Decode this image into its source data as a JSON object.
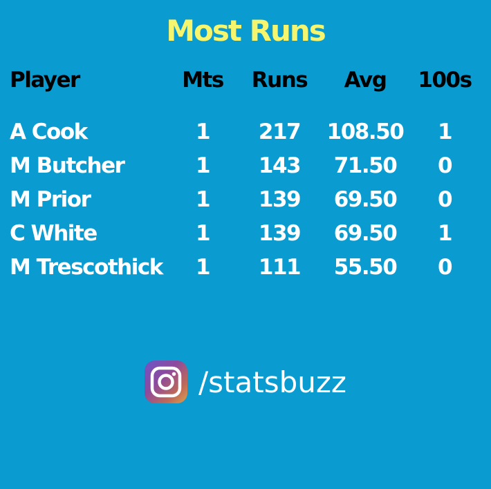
{
  "title": "Most Runs",
  "columns": {
    "player": "Player",
    "mts": "Mts",
    "runs": "Runs",
    "avg": "Avg",
    "hundreds": "100s"
  },
  "rows": [
    {
      "player": "A Cook",
      "mts": "1",
      "runs": "217",
      "avg": "108.50",
      "hundreds": "1"
    },
    {
      "player": "M Butcher",
      "mts": "1",
      "runs": "143",
      "avg": "71.50",
      "hundreds": "0"
    },
    {
      "player": "M Prior",
      "mts": "1",
      "runs": "139",
      "avg": "69.50",
      "hundreds": "0"
    },
    {
      "player": "C White",
      "mts": "1",
      "runs": "139",
      "avg": "69.50",
      "hundreds": "1"
    },
    {
      "player": "M Trescothick",
      "mts": "1",
      "runs": "111",
      "avg": "55.50",
      "hundreds": "0"
    }
  ],
  "footer": {
    "icon": "instagram-icon",
    "handle": "/statsbuzz"
  },
  "colors": {
    "background": "#0a9bd0",
    "title": "#f5f56e",
    "header_text": "#000000",
    "row_text": "#ffffff"
  }
}
